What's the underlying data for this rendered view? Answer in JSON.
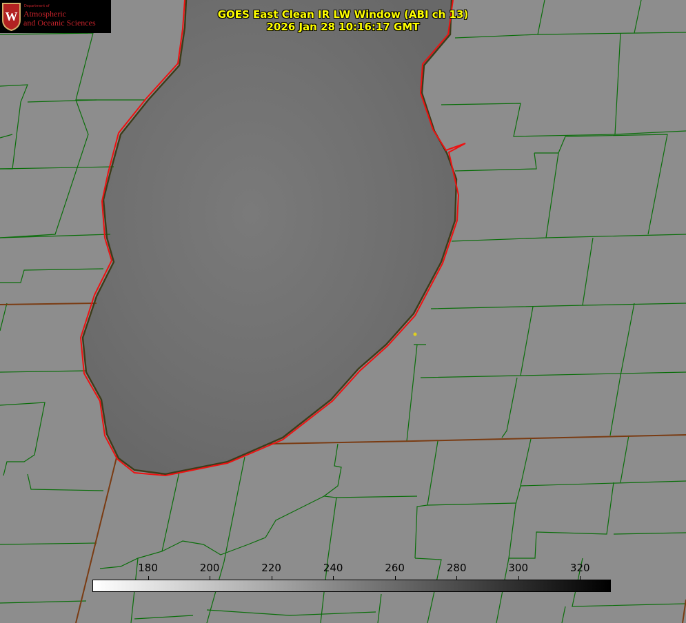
{
  "title": {
    "line1": "GOES East Clean IR LW Window (ABI ch 13)",
    "line2": "2026 Jan 28 10:16:17 GMT"
  },
  "logo": {
    "department": "Department of",
    "line1": "Atmospheric",
    "line2": "and Oceanic Sciences",
    "crest_letter": "W"
  },
  "colorbar": {
    "min": 162,
    "max": 330,
    "ticks": [
      "180",
      "200",
      "220",
      "240",
      "260",
      "280",
      "300",
      "320"
    ],
    "gradient": [
      "#ffffff",
      "#000000"
    ]
  },
  "colors": {
    "land": "#8c8c8c",
    "lake": "#6e6e6e",
    "county_border": "#0a6e0a",
    "shoreline": "#ee1111",
    "state_border": "#7a3b12",
    "title": "#ffff00",
    "logo_red": "#c6232b"
  }
}
